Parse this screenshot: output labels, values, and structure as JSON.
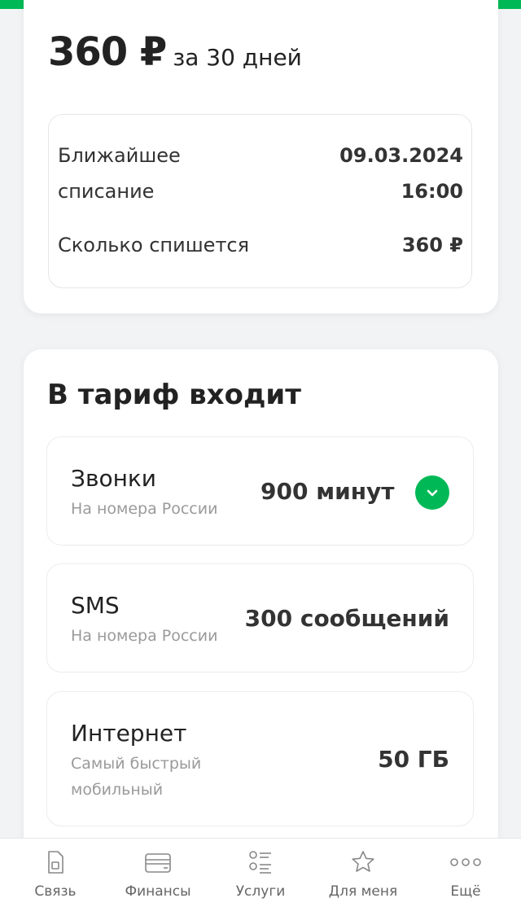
{
  "tariff": {
    "price": "360 ₽",
    "period": "за 30 дней",
    "next_charge_label_line1": "Ближайшее",
    "next_charge_label_line2": "списание",
    "next_charge_date": "09.03.2024",
    "next_charge_time": "16:00",
    "charge_amount_label": "Сколько спишется",
    "charge_amount": "360 ₽"
  },
  "includes": {
    "title": "В тариф входит",
    "items": [
      {
        "title": "Звонки",
        "subtitle": "На номера России",
        "value": "900 минут",
        "expand_icon": "chevron-down-icon"
      },
      {
        "title": "SMS",
        "subtitle": "На номера России",
        "value": "300 сообщений"
      },
      {
        "title": "Интернет",
        "subtitle_line1": "Самый быстрый",
        "subtitle_line2": "мобильный",
        "value": "50 ГБ"
      }
    ]
  },
  "bottom_nav": [
    {
      "label": "Связь",
      "icon": "sim-card-icon"
    },
    {
      "label": "Финансы",
      "icon": "wallet-icon"
    },
    {
      "label": "Услуги",
      "icon": "services-list-icon"
    },
    {
      "label": "Для меня",
      "icon": "star-icon"
    },
    {
      "label": "Ещё",
      "icon": "more-dots-icon"
    }
  ],
  "colors": {
    "accent": "#00b956",
    "background": "#f2f3f5",
    "card": "#ffffff"
  }
}
